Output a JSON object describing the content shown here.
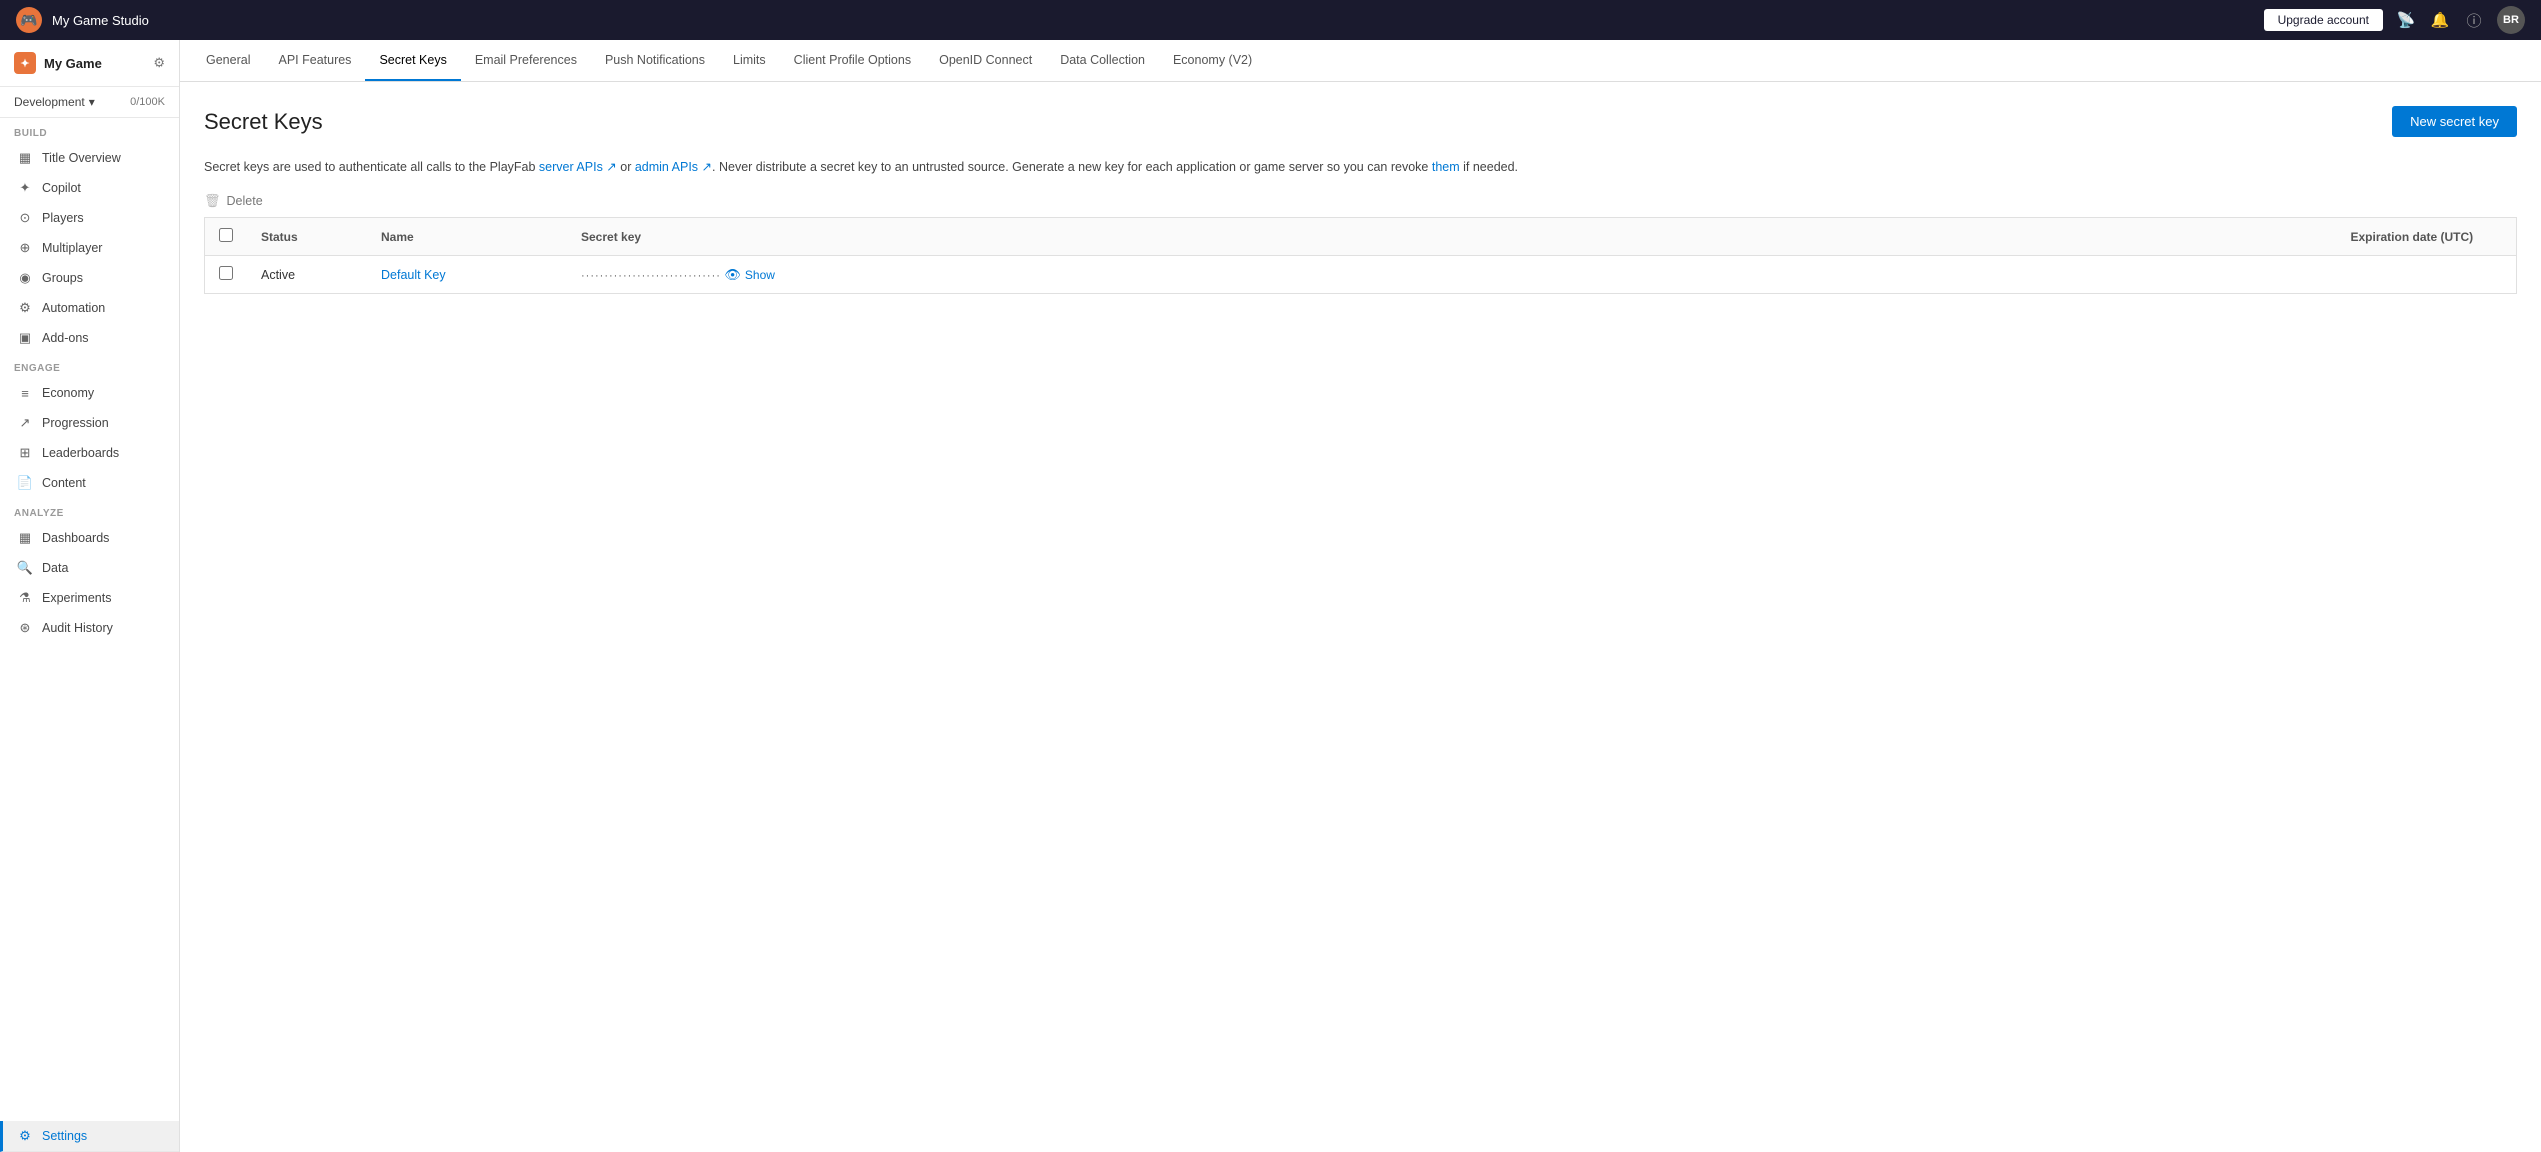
{
  "topbar": {
    "studio_name": "My Game Studio",
    "upgrade_label": "Upgrade account",
    "avatar_initials": "BR"
  },
  "sidebar": {
    "app_name": "My Game",
    "env": {
      "name": "Development",
      "count": "0/100K"
    },
    "build_label": "BUILD",
    "engage_label": "ENGAGE",
    "analyze_label": "ANALYZE",
    "build_items": [
      {
        "id": "title-overview",
        "label": "Title Overview",
        "icon": "▦"
      },
      {
        "id": "copilot",
        "label": "Copilot",
        "icon": "✦"
      },
      {
        "id": "players",
        "label": "Players",
        "icon": "⊙"
      },
      {
        "id": "multiplayer",
        "label": "Multiplayer",
        "icon": "⊕"
      },
      {
        "id": "groups",
        "label": "Groups",
        "icon": "◉"
      },
      {
        "id": "automation",
        "label": "Automation",
        "icon": "⚙"
      },
      {
        "id": "add-ons",
        "label": "Add-ons",
        "icon": "▣"
      }
    ],
    "engage_items": [
      {
        "id": "economy",
        "label": "Economy",
        "icon": "≡"
      },
      {
        "id": "progression",
        "label": "Progression",
        "icon": "↗"
      },
      {
        "id": "leaderboards",
        "label": "Leaderboards",
        "icon": "⊞"
      },
      {
        "id": "content",
        "label": "Content",
        "icon": "📄"
      }
    ],
    "analyze_items": [
      {
        "id": "dashboards",
        "label": "Dashboards",
        "icon": "▦"
      },
      {
        "id": "data",
        "label": "Data",
        "icon": "🔍"
      },
      {
        "id": "experiments",
        "label": "Experiments",
        "icon": "⚗"
      },
      {
        "id": "audit-history",
        "label": "Audit History",
        "icon": "⊛"
      }
    ],
    "settings_label": "Settings"
  },
  "tabs": [
    {
      "id": "general",
      "label": "General"
    },
    {
      "id": "api-features",
      "label": "API Features"
    },
    {
      "id": "secret-keys",
      "label": "Secret Keys",
      "active": true
    },
    {
      "id": "email-preferences",
      "label": "Email Preferences"
    },
    {
      "id": "push-notifications",
      "label": "Push Notifications"
    },
    {
      "id": "limits",
      "label": "Limits"
    },
    {
      "id": "client-profile-options",
      "label": "Client Profile Options"
    },
    {
      "id": "openid-connect",
      "label": "OpenID Connect"
    },
    {
      "id": "data-collection",
      "label": "Data Collection"
    },
    {
      "id": "economy-v2",
      "label": "Economy (V2)"
    }
  ],
  "page": {
    "title": "Secret Keys",
    "new_key_button": "New secret key",
    "description": "Secret keys are used to authenticate all calls to the PlayFab ",
    "server_apis_link": "server APIs",
    "or_text": " or ",
    "admin_apis_link": "admin APIs",
    "description_end": ". Never distribute a secret key to an untrusted source. Generate a new key for each application or game server so you can revoke ",
    "them_link": "them",
    "description_final": " if needed.",
    "delete_label": "Delete",
    "table": {
      "col_status": "Status",
      "col_name": "Name",
      "col_secret_key": "Secret key",
      "col_expiration": "Expiration date (UTC)",
      "rows": [
        {
          "status": "Active",
          "name": "Default Key",
          "key_dots": "······································",
          "show_label": "Show"
        }
      ]
    }
  }
}
